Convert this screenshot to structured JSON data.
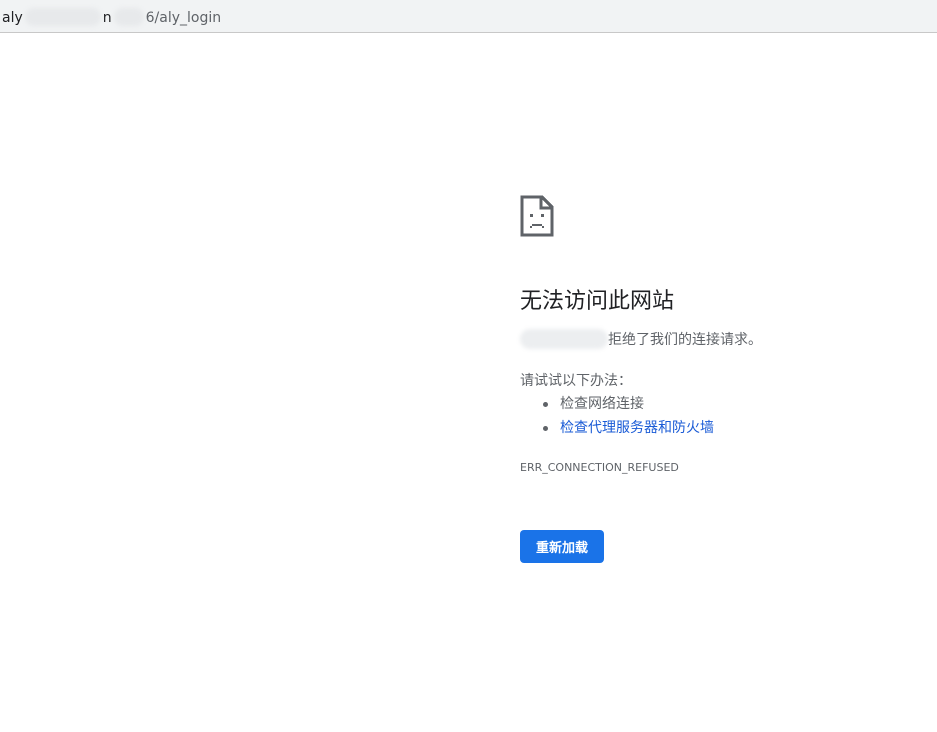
{
  "browser": {
    "url_host_prefix": "aly",
    "url_host_mid": "n",
    "url_path": "6/aly_login"
  },
  "error_page": {
    "icon": "sad-page-icon",
    "title": "无法访问此网站",
    "description_suffix": "拒绝了我们的连接请求。",
    "suggestion_heading": "请试试以下办法：",
    "suggestions": [
      {
        "label": "检查网络连接",
        "link": false
      },
      {
        "label": "检查代理服务器和防火墙",
        "link": true
      }
    ],
    "error_code": "ERR_CONNECTION_REFUSED",
    "reload_label": "重新加载"
  },
  "colors": {
    "accent": "#1a73e8",
    "link": "#1a5bd6",
    "text_primary": "#202124",
    "text_secondary": "#5f6368"
  }
}
